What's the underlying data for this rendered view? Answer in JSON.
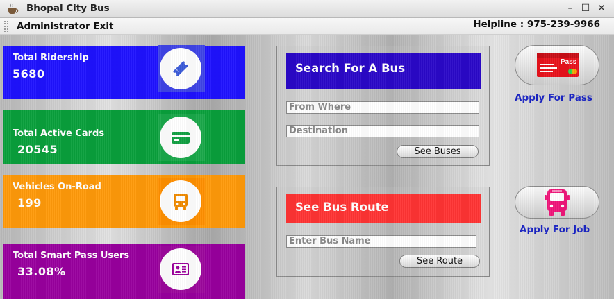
{
  "window": {
    "title": "Bhopal City Bus",
    "minimize": "–",
    "maximize": "☐",
    "close": "✕"
  },
  "menubar": {
    "item": "Administrator Exit",
    "helpline": "Helpline : 975-239-9966"
  },
  "stats": [
    {
      "label": "Total Ridership",
      "value": "5680",
      "color": "#1f12ff",
      "icon": "ticket-icon"
    },
    {
      "label": "Total Active Cards",
      "value": "20545",
      "color": "#09a03c",
      "icon": "card-icon"
    },
    {
      "label": "Vehicles On-Road",
      "value": "199",
      "color": "#ff9a0a",
      "icon": "bus-icon"
    },
    {
      "label": "Total Smart Pass Users",
      "value": "33.08%",
      "color": "#99009e",
      "icon": "id-card-icon"
    }
  ],
  "search_panel": {
    "header": "Search For A Bus",
    "header_color": "#2a08c8",
    "from_placeholder": "From Where",
    "destination_placeholder": "Destination",
    "button": "See Buses"
  },
  "route_panel": {
    "header": "See Bus Route",
    "header_color": "#ff3434",
    "bus_name_placeholder": "Enter Bus Name",
    "button": "See Route"
  },
  "actions": {
    "pass": {
      "label": "Apply For Pass",
      "icon": "pass-icon",
      "pass_text": "Pass"
    },
    "job": {
      "label": "Apply For Job",
      "icon": "bus-front-icon"
    }
  }
}
